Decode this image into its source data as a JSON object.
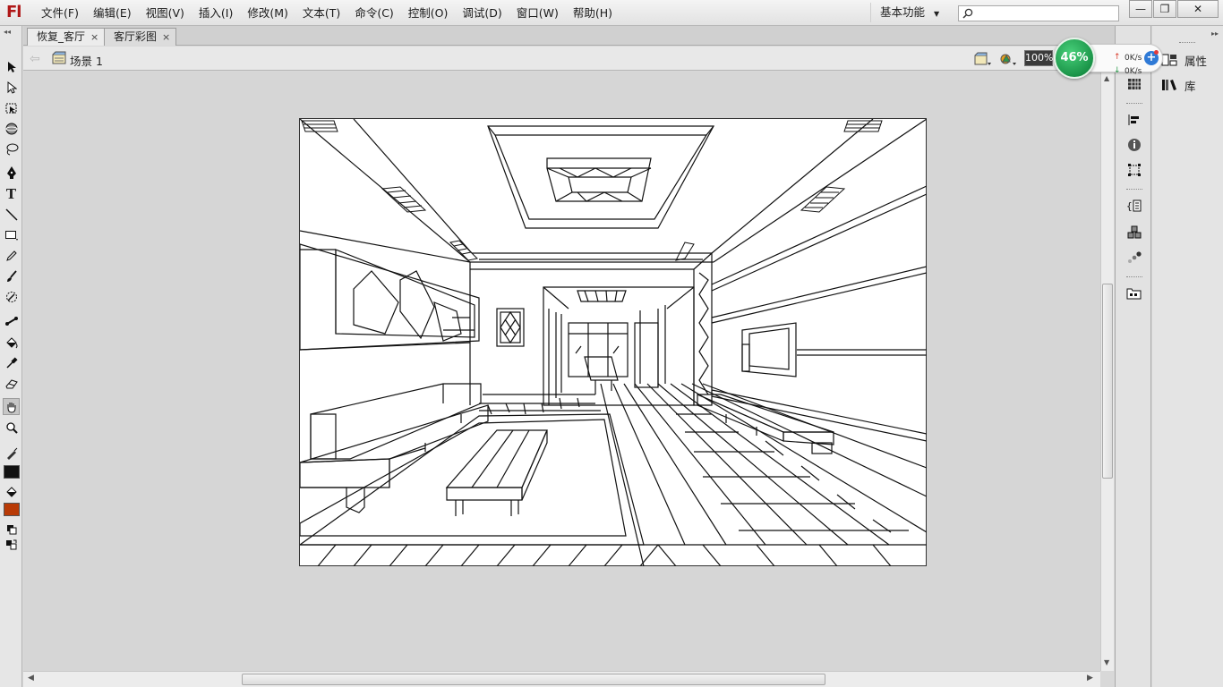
{
  "app": {
    "logo": "Fl",
    "menu": [
      "文件(F)",
      "编辑(E)",
      "视图(V)",
      "插入(I)",
      "修改(M)",
      "文本(T)",
      "命令(C)",
      "控制(O)",
      "调试(D)",
      "窗口(W)",
      "帮助(H)"
    ],
    "workspace": "基本功能",
    "search_placeholder": "",
    "window_buttons": {
      "minimize": "—",
      "restore": "❐",
      "close": "✕"
    }
  },
  "tabs": [
    {
      "label": "恢复_客厅",
      "close": "×"
    },
    {
      "label": "客厅彩图",
      "close": "×"
    }
  ],
  "editbar": {
    "scene": "场景 1",
    "zoom": "100%"
  },
  "tools": {
    "stroke_color": "#111111",
    "fill_color": "#b83a06"
  },
  "network": {
    "percent": "46%",
    "upload": "0K/s",
    "download": "0K/s"
  },
  "panels": {
    "properties": "属性",
    "library": "库"
  }
}
